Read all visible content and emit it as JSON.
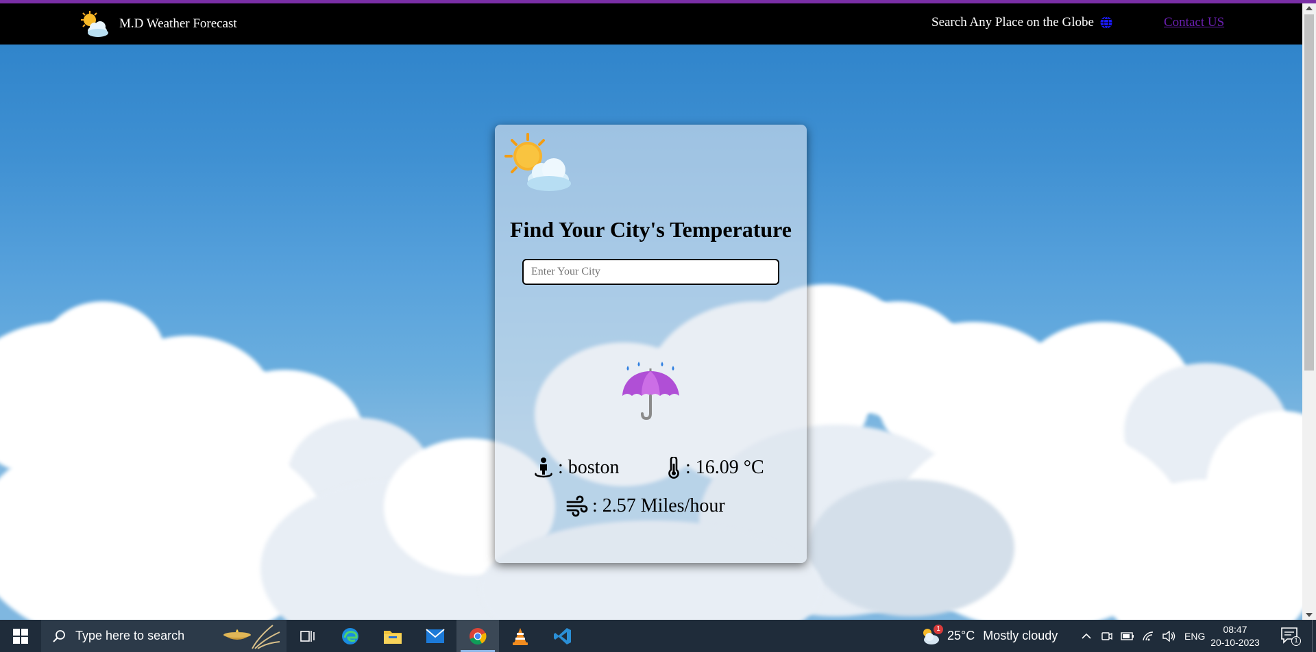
{
  "navbar": {
    "brand_title": "M.D Weather Forecast",
    "search_text": "Search Any Place on the Globe",
    "contact_label": "Contact US"
  },
  "card": {
    "heading": "Find Your City's Temperature",
    "input_placeholder": "Enter Your City",
    "input_value": "",
    "city_value": ": boston",
    "temperature_value": ": 16.09 °C",
    "wind_value": ": 2.57 Miles/hour"
  },
  "taskbar": {
    "search_placeholder": "Type here to search",
    "weather_temp": "25°C",
    "weather_condition": "Mostly cloudy",
    "weather_badge": "1",
    "language": "ENG",
    "time": "08:47",
    "date": "20-10-2023",
    "notification_count": "1",
    "apps": [
      "task-view",
      "edge",
      "file-explorer",
      "mail",
      "chrome",
      "vlc",
      "vscode"
    ],
    "active_app": "chrome"
  },
  "colors": {
    "accent_bar": "#7a2fa6",
    "navbar_bg": "#000000",
    "contact_link": "#6a1fb0",
    "sky": "#3f90d2",
    "taskbar_bg": "#1f2c3a"
  }
}
